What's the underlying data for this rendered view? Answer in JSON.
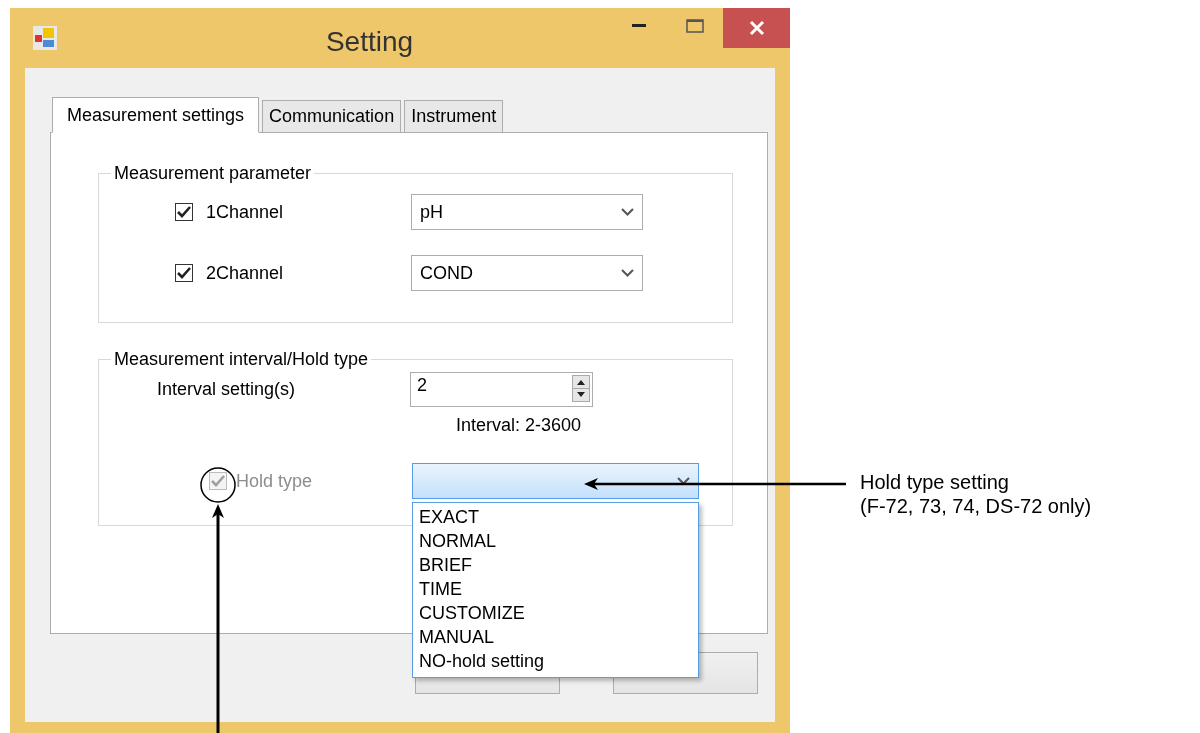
{
  "window": {
    "title": "Setting"
  },
  "tabs": [
    {
      "label": "Measurement settings",
      "selected": true
    },
    {
      "label": "Communication",
      "selected": false
    },
    {
      "label": "Instrument",
      "selected": false
    }
  ],
  "measurement_parameter": {
    "title": "Measurement parameter",
    "channels": [
      {
        "label": "1Channel",
        "checked": true,
        "value": "pH"
      },
      {
        "label": "2Channel",
        "checked": true,
        "value": "COND"
      }
    ]
  },
  "interval_group": {
    "title": "Measurement interval/Hold type",
    "interval": {
      "label": "Interval setting(s)",
      "value": "2",
      "hint": "Interval: 2-3600"
    },
    "hold_type": {
      "label": "Hold type",
      "checked": true,
      "disabled": true,
      "expanded": true,
      "options": [
        "EXACT",
        "NORMAL",
        "BRIEF",
        "TIME",
        "CUSTOMIZE",
        "MANUAL",
        "NO-hold setting"
      ]
    }
  },
  "buttons": [
    {
      "enabled": true
    },
    {
      "enabled": true
    }
  ],
  "callout": {
    "lines": [
      "Hold type setting",
      "(F-72, 73, 74, DS-72 only)"
    ]
  }
}
